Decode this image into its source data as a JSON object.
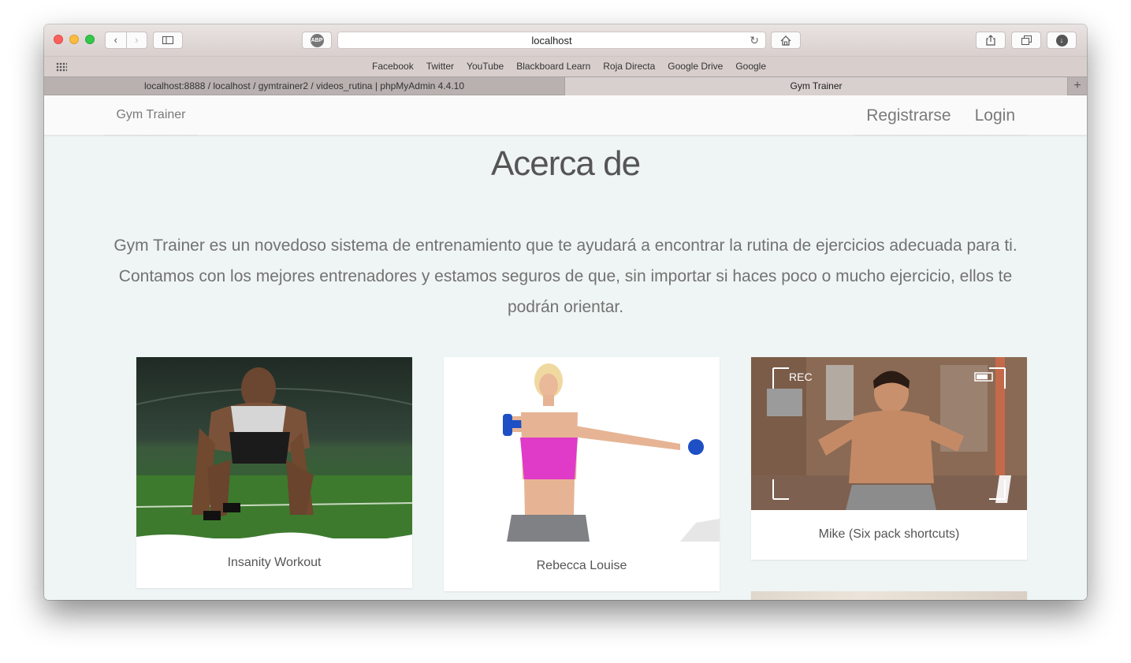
{
  "browser": {
    "address": "localhost",
    "abp_label": "ABP",
    "bookmarks": [
      "Facebook",
      "Twitter",
      "YouTube",
      "Blackboard Learn",
      "Roja Directa",
      "Google Drive",
      "Google"
    ],
    "tabs": [
      {
        "title": "localhost:8888 / localhost / gymtrainer2 / videos_rutina | phpMyAdmin 4.4.10"
      },
      {
        "title": "Gym Trainer"
      }
    ]
  },
  "navbar": {
    "brand": "Gym Trainer",
    "register": "Registrarse",
    "login": "Login"
  },
  "main": {
    "title": "Acerca de",
    "intro": "Gym Trainer es un novedoso sistema de entrenamiento que te ayudará a encontrar la rutina de ejercicios adecuada para ti. Contamos con los mejores entrenadores y estamos seguros de que, sin importar si haces poco o mucho ejercicio, ellos te podrán orientar.",
    "trainers": [
      {
        "name": "Insanity Workout"
      },
      {
        "name": "Rebecca Louise"
      },
      {
        "name": "Mike (Six pack shortcuts)",
        "overlay_rec": "REC"
      }
    ]
  }
}
